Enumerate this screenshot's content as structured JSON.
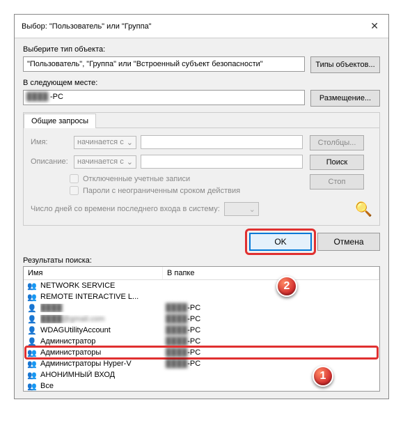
{
  "title": "Выбор: \"Пользователь\" или \"Группа\"",
  "object_type_label": "Выберите тип объекта:",
  "object_type_value": "\"Пользователь\", \"Группа\" или \"Встроенный субъект безопасности\"",
  "btn_object_types": "Типы объектов...",
  "location_label": "В следующем месте:",
  "location_value": "-PC",
  "btn_locations": "Размещение...",
  "tab_common": "Общие запросы",
  "form": {
    "name_label": "Имя:",
    "desc_label": "Описание:",
    "combo_starts": "начинается с",
    "chk_disabled": "Отключенные учетные записи",
    "chk_pwd": "Пароли с неограниченным сроком действия",
    "days_label": "Число дней со времени последнего входа в систему:"
  },
  "btn_columns": "Столбцы...",
  "btn_find": "Поиск",
  "btn_stop": "Стоп",
  "btn_ok": "OK",
  "btn_cancel": "Отмена",
  "results_label": "Результаты поиска:",
  "res_col1": "Имя",
  "res_col2": "В папке",
  "rows": [
    {
      "icon": "group",
      "name": "NETWORK SERVICE",
      "folder": ""
    },
    {
      "icon": "group",
      "name": "REMOTE INTERACTIVE L...",
      "folder": ""
    },
    {
      "icon": "user",
      "name": "████",
      "folder": "████-PC",
      "blur": true
    },
    {
      "icon": "user",
      "name": "████@gmail.com",
      "folder": "████-PC",
      "blur": true
    },
    {
      "icon": "user",
      "name": "WDAGUtilityAccount",
      "folder": "████-PC"
    },
    {
      "icon": "user",
      "name": "Администратор",
      "folder": "████-PC"
    },
    {
      "icon": "group",
      "name": "Администраторы",
      "folder": "████-PC",
      "hl": true
    },
    {
      "icon": "group",
      "name": "Администраторы Hyper-V",
      "folder": "████-PC"
    },
    {
      "icon": "group",
      "name": "АНОНИМНЫЙ ВХОД",
      "folder": ""
    },
    {
      "icon": "group",
      "name": "Все",
      "folder": ""
    }
  ],
  "badges": {
    "b1": "1",
    "b2": "2"
  }
}
